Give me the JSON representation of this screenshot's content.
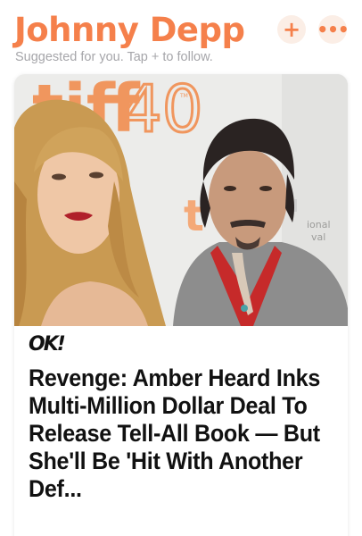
{
  "header": {
    "title": "Johnny Depp",
    "follow_label": "+",
    "more_label": "•••",
    "subtitle": "Suggested for you. Tap + to follow."
  },
  "backdrop": {
    "brand_mark": "tiff",
    "anniversary": "40",
    "trademark": "TM",
    "side_text_1": "ional",
    "side_text_2": "val"
  },
  "article": {
    "publisher": "OK!",
    "headline": "Revenge: Amber Heard Inks Multi-Million Dollar Deal To Release Tell-All Book — But She'll Be 'Hit With Another Def..."
  },
  "colors": {
    "accent": "#f5804b",
    "accent_bg": "#fbeee6",
    "subtitle": "#a6a6aa",
    "headline": "#111111"
  }
}
